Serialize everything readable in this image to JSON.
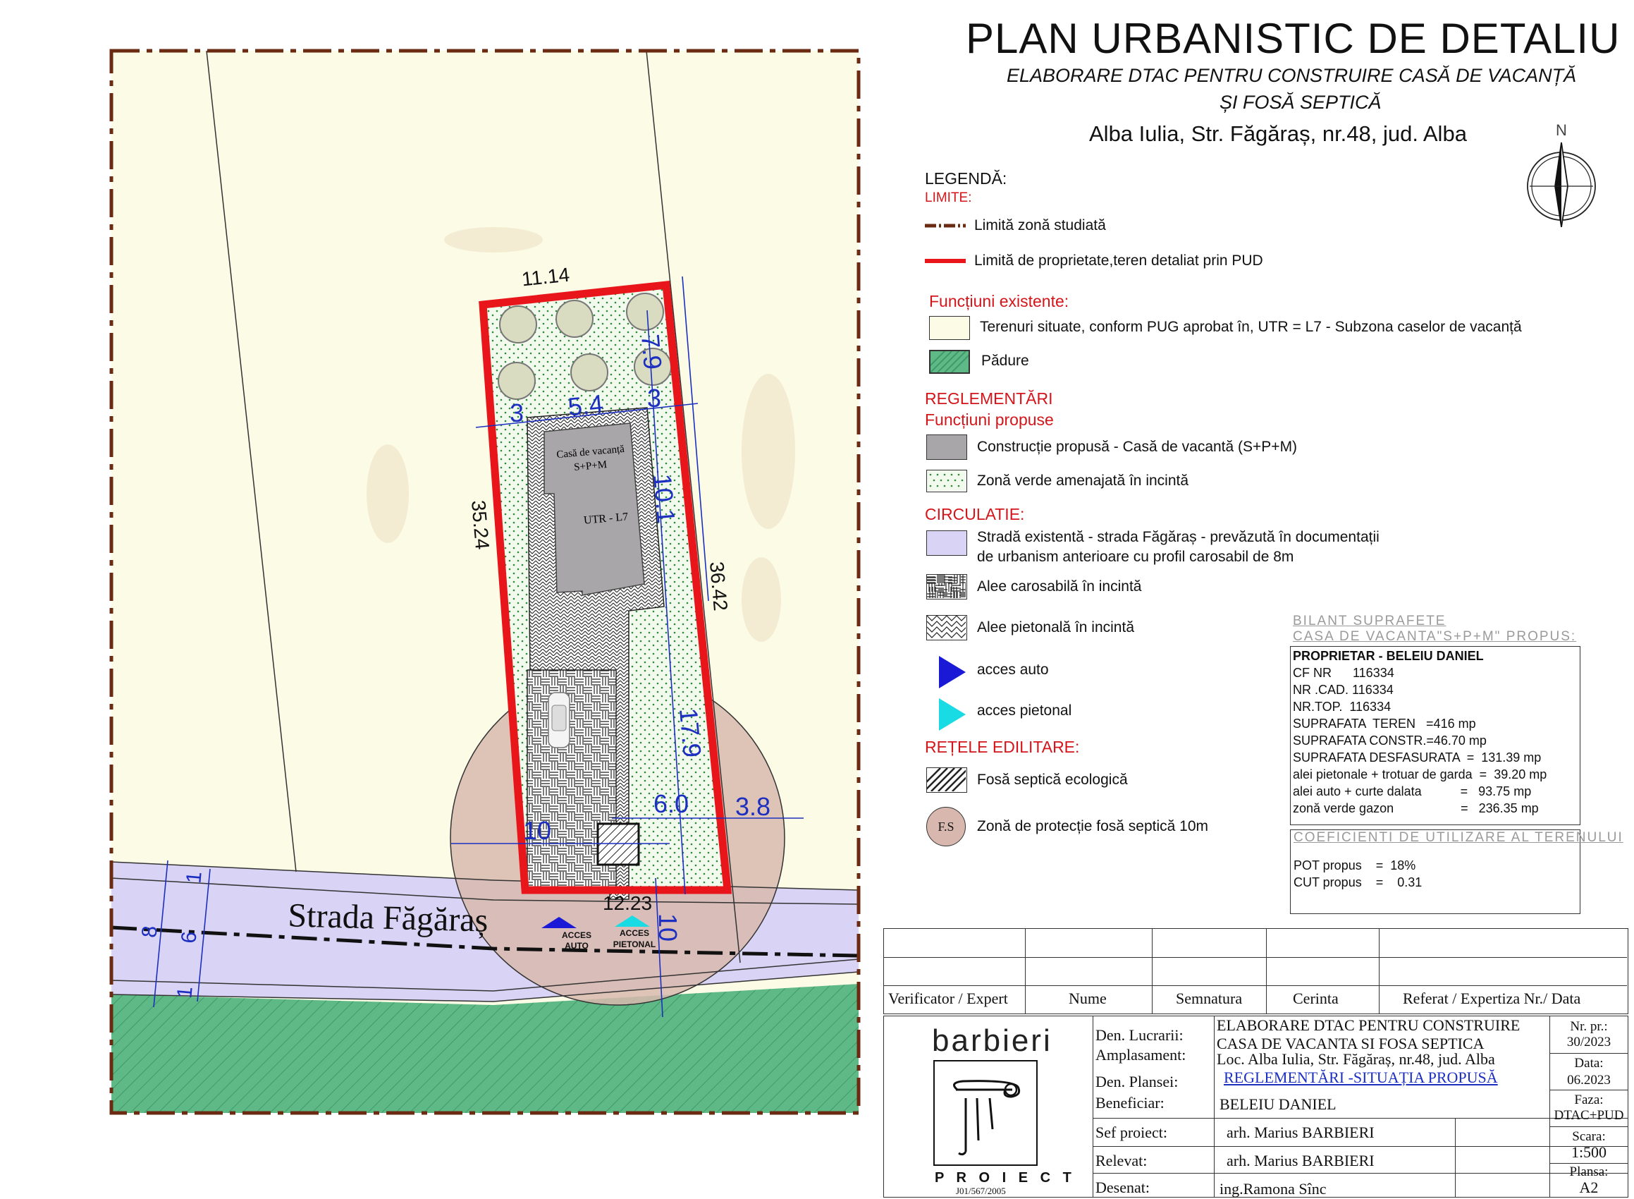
{
  "header": {
    "title": "PLAN URBANISTIC DE DETALIU",
    "subtitle1": "ELABORARE DTAC PENTRU CONSTRUIRE CASĂ DE VACANȚĂ",
    "subtitle2": "ȘI FOSĂ SEPTICĂ",
    "location": "Alba Iulia, Str. Făgăraș, nr.48, jud. Alba",
    "north_label": "N"
  },
  "legend": {
    "title": "LEGENDĂ:",
    "limits_head": "LIMITE:",
    "limit_zone": "Limită zonă studiată",
    "limit_property": "Limită de proprietate,teren detaliat prin PUD",
    "existing_head": "Funcțiuni existente:",
    "existing_land": "Terenuri situate, conform PUG aprobat în, UTR = L7 - Subzona caselor de vacanță",
    "forest": "Pădure",
    "regs_head": "REGLEMENTĂRI",
    "proposed_head": "Funcțiuni propuse",
    "proposed_building": "Construcție propusă - Casă de vacantă (S+P+M)",
    "green_zone": "Zonă verde amenajată în incintă",
    "circulation_head": "CIRCULATIE:",
    "street_line1": "Stradă existentă - strada Făgăraș - prevăzută în documentații",
    "street_line2": "de urbanism anterioare cu profil carosabil de 8m",
    "car_alley": "Alee carosabilă în incintă",
    "ped_alley": "Alee pietonală în incintă",
    "acces_auto": "acces auto",
    "acces_pietonal": "acces pietonal",
    "networks_head": "REȚELE EDILITARE:",
    "septic": "Fosă septică ecologică",
    "protection_symbol": "F.S",
    "protection": "Zonă de protecție fosă septică 10m"
  },
  "balance": {
    "title1": "BILANT SUPRAFETE",
    "title2": "CASA DE VACANTA\"S+P+M\" PROPUS:",
    "owner": "PROPRIETAR - BELEIU DANIEL",
    "rows": [
      "CF NR      116334",
      "NR .CAD. 116334",
      "NR.TOP.  116334",
      "SUPRAFATA  TEREN   =416 mp",
      "SUPRAFATA CONSTR.=46.70 mp",
      "SUPRAFATA DESFASURATA  =  131.39 mp",
      "alei pietonale + trotuar de garda  =  39.20 mp",
      "alei auto + curte dalata           =   93.75 mp",
      "zonă verde gazon                   =   236.35 mp"
    ],
    "coef_title": "COEFICIENTI DE UTILIZARE AL TERENULUI",
    "pot": "POT propus    =  18%",
    "cut": "CUT propus    =    0.31"
  },
  "signatures": {
    "col1": "Verificator / Expert",
    "col2": "Nume",
    "col3": "Semnatura",
    "col4": "Cerinta",
    "col5": "Referat / Expertiza Nr./ Data"
  },
  "titleblock": {
    "logo_name": "barbieri",
    "logo_proiect": "P R O I E C T",
    "logo_reg": "J01/567/2005",
    "den_lucrarii_label": "Den. Lucrarii:",
    "amplasament_label": "Amplasament:",
    "den_lucrarii_1": "ELABORARE DTAC PENTRU CONSTRUIRE",
    "den_lucrarii_2": "CASA DE VACANTA SI FOSA SEPTICA",
    "amplasament": "Loc. Alba Iulia, Str. Făgăraș, nr.48, jud. Alba",
    "den_plansei_label": "Den. Plansei:",
    "den_plansei": "REGLEMENTĂRI -SITUAȚIA PROPUSĂ",
    "beneficiar_label": "Beneficiar:",
    "beneficiar": "BELEIU DANIEL",
    "sef_label": "Sef proiect:",
    "sef": "arh. Marius BARBIERI",
    "relevat_label": "Relevat:",
    "relevat": "arh. Marius BARBIERI",
    "desenat_label": "Desenat:",
    "desenat": "ing.Ramona Sînc",
    "nr_pr_label": "Nr. pr.:",
    "nr_pr": "30/2023",
    "data_label": "Data:",
    "data": "06.2023",
    "faza_label": "Faza:",
    "faza": "DTAC+PUD",
    "scara_label": "Scara:",
    "scara": "1:500",
    "plansa_label": "Plansa:",
    "plansa": "A2"
  },
  "plan": {
    "dim_top": "11.14",
    "dim_left": "35.24",
    "dim_right": "36.42",
    "dim_bottom": "12.23",
    "dim_7_9": "7.9",
    "dim_3_left": "3",
    "dim_5_4": "5.4",
    "dim_3_right": "3",
    "dim_10_1": "10.1",
    "dim_17_9": "17.9",
    "dim_6_0": "6.0",
    "dim_3_8": "3.8",
    "dim_10_h": "10",
    "dim_10_v": "10",
    "house_label1": "Casă de vacanță",
    "house_label2": "S+P+M",
    "utr_label": "UTR - L7",
    "street_name": "Strada Făgăraș",
    "acces_auto_1": "ACCES",
    "acces_auto_2": "AUTO",
    "acces_ped_1": "ACCES",
    "acces_ped_2": "PIETONAL",
    "street_dim_1a": "1",
    "street_dim_6": "6",
    "street_dim_1b": "1",
    "street_dim_8": "8"
  },
  "colors": {
    "land": "#fbfbe6",
    "street": "#d9d3f5",
    "forest": "#5fb987",
    "property": "#e8161b",
    "building": "#a8a6a8",
    "protection": "#d8b8ae",
    "limit": "#6b2b12",
    "dim": "#1c2fc0"
  }
}
